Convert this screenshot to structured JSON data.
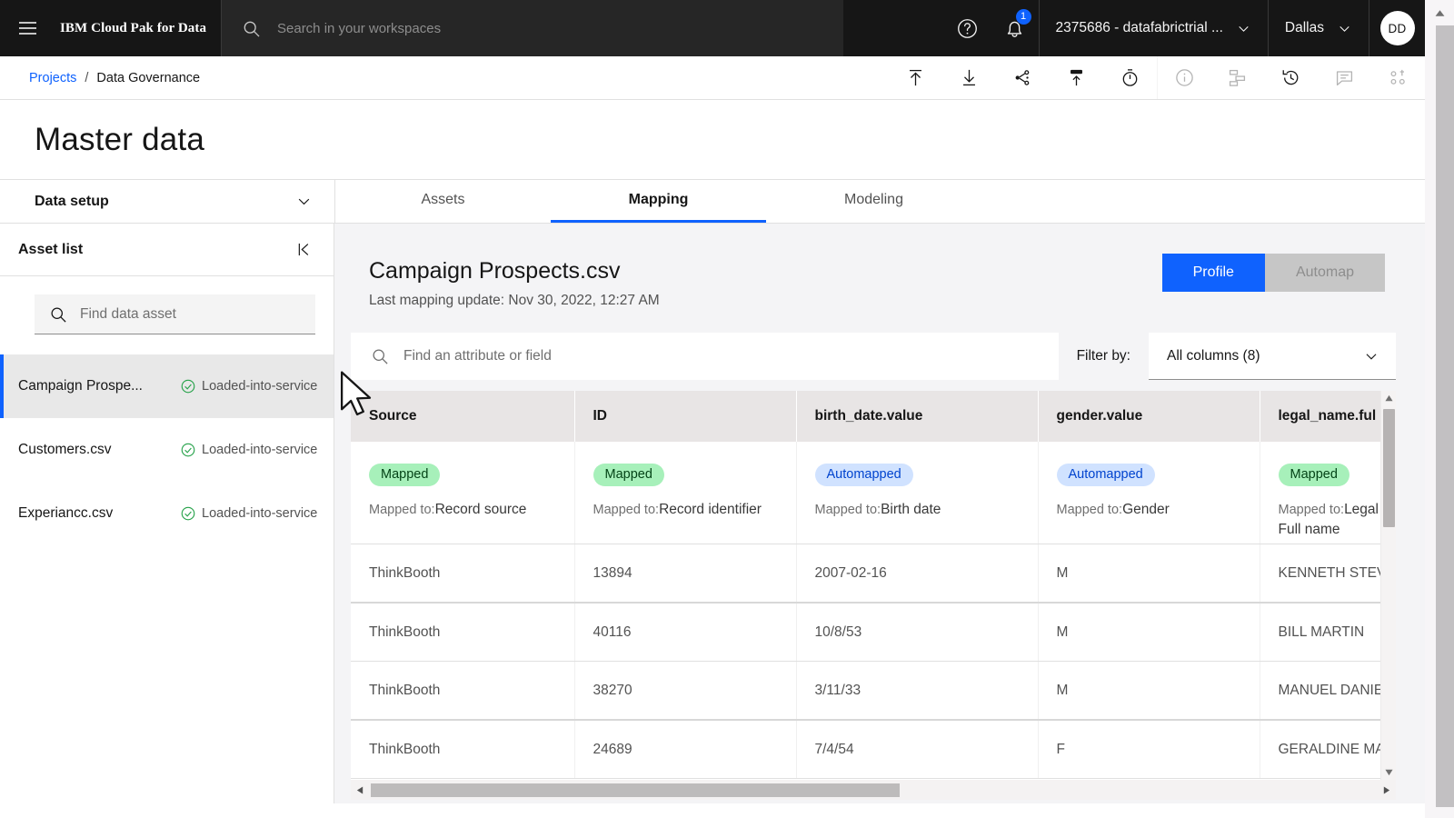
{
  "topbar": {
    "menu_label": "menu",
    "brand": "IBM Cloud Pak for Data",
    "search_placeholder": "Search in your workspaces",
    "help_label": "Help",
    "notification_count": "1",
    "account": "2375686 - datafabrictrial ...",
    "region": "Dallas",
    "avatar_initials": "DD"
  },
  "breadcrumb": {
    "root": "Projects",
    "separator": "/",
    "current": "Data Governance",
    "tools": [
      {
        "name": "publish-icon",
        "enabled": true
      },
      {
        "name": "download-icon",
        "enabled": true
      },
      {
        "name": "lineage-icon",
        "enabled": true
      },
      {
        "name": "promote-icon",
        "enabled": true
      },
      {
        "name": "timer-icon",
        "enabled": true
      },
      {
        "name": "info-icon",
        "enabled": false
      },
      {
        "name": "hierarchy-icon",
        "enabled": false
      },
      {
        "name": "history-icon",
        "enabled": true
      },
      {
        "name": "comment-icon",
        "enabled": false
      },
      {
        "name": "collaborators-icon",
        "enabled": false
      }
    ]
  },
  "page": {
    "title": "Master data"
  },
  "secondbar": {
    "data_setup_label": "Data setup",
    "tabs": [
      {
        "label": "Assets",
        "active": false
      },
      {
        "label": "Mapping",
        "active": true
      },
      {
        "label": "Modeling",
        "active": false
      }
    ]
  },
  "asset_panel": {
    "title": "Asset list",
    "collapse_label": "Collapse panel",
    "search_placeholder": "Find data asset",
    "items": [
      {
        "name": "Campaign Prospe...",
        "status": "Loaded-into-service",
        "selected": true
      },
      {
        "name": "Customers.csv",
        "status": "Loaded-into-service",
        "selected": false
      },
      {
        "name": "Experiancc.csv",
        "status": "Loaded-into-service",
        "selected": false
      }
    ]
  },
  "main": {
    "title": "Campaign Prospects.csv",
    "subtitle": "Last mapping update: Nov 30, 2022, 12:27 AM",
    "profile_button": "Profile",
    "automap_button": "Automap",
    "attribute_search_placeholder": "Find an attribute or field",
    "filter_by_label": "Filter by:",
    "filter_value": "All columns (8)"
  },
  "table": {
    "columns": [
      "Source",
      "ID",
      "birth_date.value",
      "gender.value",
      "legal_name.ful"
    ],
    "mapping_row": [
      {
        "badge": "Mapped",
        "badge_kind": "mapped",
        "mapped_to_label": "Mapped to:",
        "mapped_to": "Record source"
      },
      {
        "badge": "Mapped",
        "badge_kind": "mapped",
        "mapped_to_label": "Mapped to:",
        "mapped_to": "Record identifier"
      },
      {
        "badge": "Automapped",
        "badge_kind": "automapped",
        "mapped_to_label": "Mapped to:",
        "mapped_to": "Birth date"
      },
      {
        "badge": "Automapped",
        "badge_kind": "automapped",
        "mapped_to_label": "Mapped to:",
        "mapped_to": "Gender"
      },
      {
        "badge": "Mapped",
        "badge_kind": "mapped",
        "mapped_to_label": "Mapped to:",
        "mapped_to": "Legal Full name"
      }
    ],
    "rows": [
      {
        "source": "ThinkBooth",
        "id": "13894",
        "birth_date": "2007-02-16",
        "gender": "M",
        "legal_name": "KENNETH STEV"
      },
      {
        "source": "ThinkBooth",
        "id": "40116",
        "birth_date": "10/8/53",
        "gender": "M",
        "legal_name": "BILL MARTIN"
      },
      {
        "source": "ThinkBooth",
        "id": "38270",
        "birth_date": "3/11/33",
        "gender": "M",
        "legal_name": "MANUEL DANIE"
      },
      {
        "source": "ThinkBooth",
        "id": "24689",
        "birth_date": "7/4/54",
        "gender": "F",
        "legal_name": "GERALDINE MA"
      }
    ]
  },
  "colors": {
    "brand_blue": "#0f62fe",
    "header_black": "#161616",
    "mapped_bg": "#a7f0ba",
    "mapped_text": "#044317",
    "automapped_bg": "#d0e2ff",
    "automapped_text": "#0043ce",
    "success_green": "#24a148",
    "panel_bg": "#f4f4f6"
  }
}
